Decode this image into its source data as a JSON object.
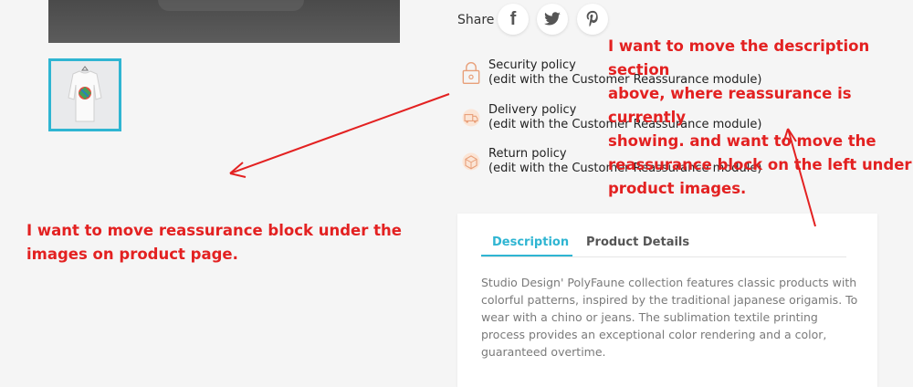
{
  "share": {
    "label": "Share",
    "buttons": [
      {
        "network": "facebook",
        "icon": "facebook-icon",
        "glyph": "f"
      },
      {
        "network": "twitter",
        "icon": "twitter-icon",
        "glyph": ""
      },
      {
        "network": "pinterest",
        "icon": "pinterest-icon",
        "glyph": "P"
      }
    ]
  },
  "reassurance": [
    {
      "title": "Security policy",
      "subtitle": "(edit with the Customer Reassurance module)",
      "icon": "lock-icon"
    },
    {
      "title": "Delivery policy",
      "subtitle": "(edit with the Customer Reassurance module)",
      "icon": "delivery-truck-icon"
    },
    {
      "title": "Return policy",
      "subtitle": "(edit with the Customer Reassurance module)",
      "icon": "return-box-icon"
    }
  ],
  "annotations": {
    "right_lines": [
      "I want to move the description section",
      "above, where reassurance is currently",
      "showing. and want to move the",
      "reassurance block on the left under",
      "product images."
    ],
    "left_lines": [
      "I want to move reassurance block under the",
      "images on product page."
    ]
  },
  "tabs": {
    "items": [
      {
        "label": "Description",
        "active": true
      },
      {
        "label": "Product Details",
        "active": false
      }
    ]
  },
  "description": {
    "text": "Studio Design' PolyFaune collection features classic products with colorful patterns, inspired by the traditional japanese origamis. To wear with a chino or jeans. The sublimation textile printing process provides an exceptional color rendering and a color, guaranteed overtime."
  },
  "colors": {
    "accent": "#2fb5d2",
    "annotation": "#e32121",
    "reassurance_icon": "#e8a07a"
  }
}
